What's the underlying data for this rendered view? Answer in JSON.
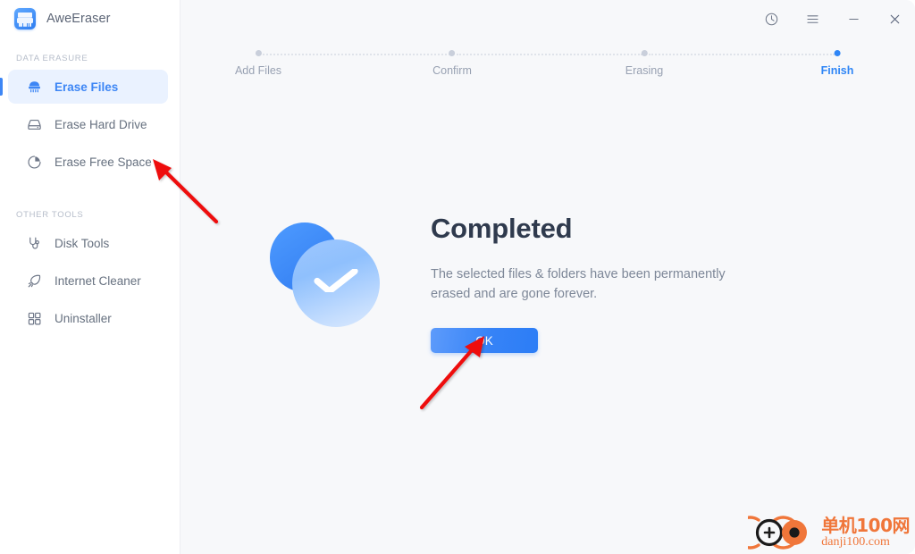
{
  "window": {
    "app_title": "AweEraser",
    "app_icon": "shredder-icon"
  },
  "titlebar": {
    "buttons": [
      {
        "name": "history-icon",
        "label": "History"
      },
      {
        "name": "menu-icon",
        "label": "Menu"
      },
      {
        "name": "minimize-icon",
        "label": "Minimize"
      },
      {
        "name": "close-icon",
        "label": "Close"
      }
    ]
  },
  "sidebar": {
    "sections": [
      {
        "label": "DATA ERASURE",
        "items": [
          {
            "label": "Erase Files",
            "icon": "shredder-icon",
            "active": true
          },
          {
            "label": "Erase Hard Drive",
            "icon": "harddrive-icon",
            "active": false
          },
          {
            "label": "Erase Free Space",
            "icon": "piechart-icon",
            "active": false
          }
        ]
      },
      {
        "label": "OTHER TOOLS",
        "items": [
          {
            "label": "Disk Tools",
            "icon": "stethoscope-icon",
            "active": false
          },
          {
            "label": "Internet Cleaner",
            "icon": "rocket-icon",
            "active": false
          },
          {
            "label": "Uninstaller",
            "icon": "grid-icon",
            "active": false
          }
        ]
      }
    ]
  },
  "stepper": {
    "steps": [
      {
        "label": "Add Files",
        "state": "pending"
      },
      {
        "label": "Confirm",
        "state": "pending"
      },
      {
        "label": "Erasing",
        "state": "pending"
      },
      {
        "label": "Finish",
        "state": "current"
      }
    ]
  },
  "main": {
    "status_icon": "check-circle-icon",
    "title": "Completed",
    "description": "The selected files & folders have been permanently erased and are gone forever.",
    "ok_label": "OK"
  },
  "annotations": [
    {
      "name": "arrow-to-erase-free-space",
      "color": "#ee1111"
    },
    {
      "name": "arrow-to-ok-button",
      "color": "#ee1111"
    }
  ],
  "watermark": {
    "cn": "单机100网",
    "en": "danji100.com",
    "color": "#f0763a"
  },
  "colors": {
    "accent": "#2f86f6",
    "sidebar_bg": "#ffffff",
    "main_bg": "#f7f8fa",
    "title_text": "#2f3a4d",
    "muted_text": "#7d8798"
  }
}
